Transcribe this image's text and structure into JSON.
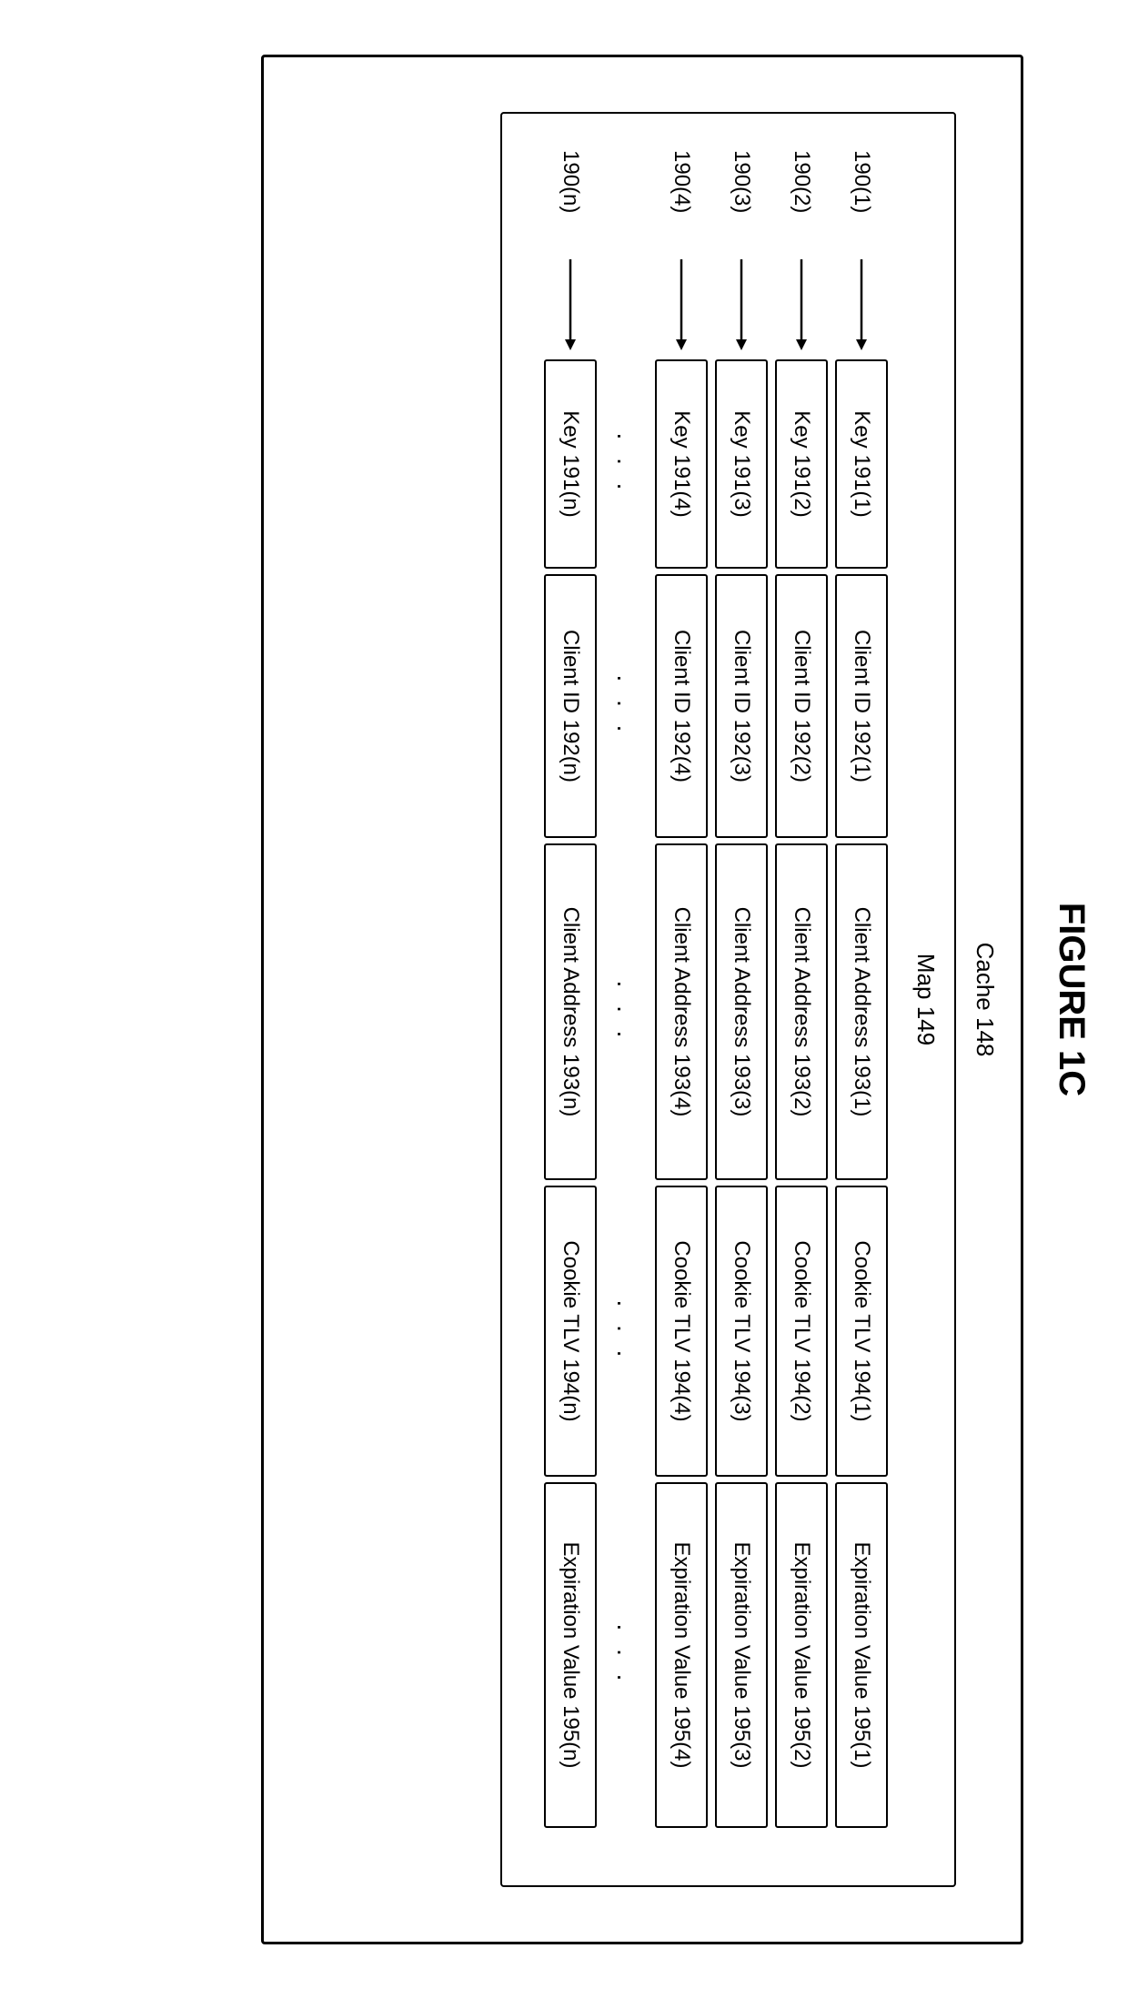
{
  "figure_title": "FIGURE 1C",
  "cache_label": "Cache 148",
  "map_label": "Map 149",
  "ellipsis": ". . .",
  "rows": [
    {
      "label": "190(1)",
      "key": "Key 191(1)",
      "client_id": "Client ID 192(1)",
      "client_addr": "Client Address 193(1)",
      "cookie_tlv": "Cookie TLV 194(1)",
      "expiration": "Expiration Value 195(1)"
    },
    {
      "label": "190(2)",
      "key": "Key 191(2)",
      "client_id": "Client ID 192(2)",
      "client_addr": "Client Address 193(2)",
      "cookie_tlv": "Cookie TLV 194(2)",
      "expiration": "Expiration Value 195(2)"
    },
    {
      "label": "190(3)",
      "key": "Key 191(3)",
      "client_id": "Client ID 192(3)",
      "client_addr": "Client Address 193(3)",
      "cookie_tlv": "Cookie TLV 194(3)",
      "expiration": "Expiration Value 195(3)"
    },
    {
      "label": "190(4)",
      "key": "Key 191(4)",
      "client_id": "Client ID 192(4)",
      "client_addr": "Client Address 193(4)",
      "cookie_tlv": "Cookie TLV 194(4)",
      "expiration": "Expiration Value 195(4)"
    }
  ],
  "row_n": {
    "label": "190(n)",
    "key": "Key 191(n)",
    "client_id": "Client ID 192(n)",
    "client_addr": "Client Address 193(n)",
    "cookie_tlv": "Cookie TLV 194(n)",
    "expiration": "Expiration Value 195(n)"
  }
}
